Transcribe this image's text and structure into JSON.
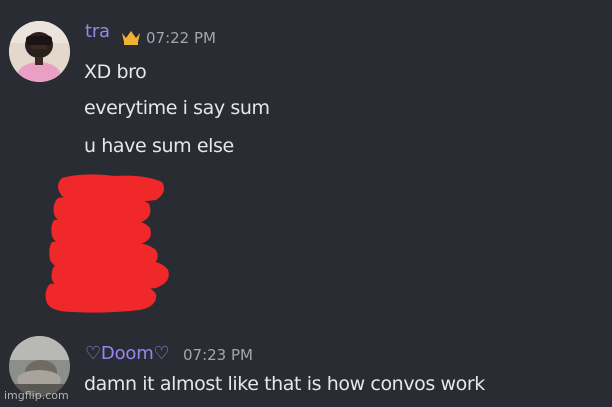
{
  "messages": [
    {
      "username": "tra",
      "timestamp": "07:22 PM",
      "username_color": "#9b84ee",
      "badge": "crown-icon",
      "badge_color": "#f0b232",
      "lines": [
        "XD bro",
        "everytime i say sum",
        "u have sum else"
      ],
      "has_redaction": true,
      "redaction_color": "#f0282a"
    },
    {
      "username": "♡Doom♡",
      "timestamp": "07:23 PM",
      "username_color": "#9b84ee",
      "lines": [
        "damn it almost like that is how convos work"
      ]
    }
  ],
  "watermark": "imgflip.com"
}
